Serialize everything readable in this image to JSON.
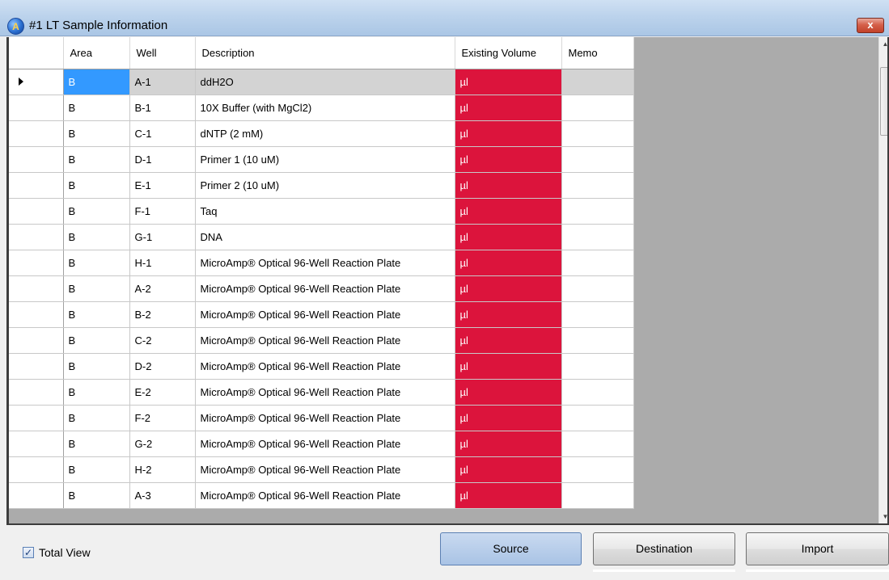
{
  "window": {
    "title": "#1 LT Sample Information",
    "app_icon": "autoit-globe-icon",
    "close_label": "x",
    "close_icon": "close-icon"
  },
  "grid": {
    "columns": [
      "Area",
      "Well",
      "Description",
      "Existing Volume",
      "Memo"
    ],
    "selected_row_index": 0,
    "volume_cell_color": "#dc143c",
    "selection_color": "#3399ff",
    "rows": [
      {
        "area": "B",
        "well": "A-1",
        "description": "ddH2O",
        "volume": "µl",
        "memo": ""
      },
      {
        "area": "B",
        "well": "B-1",
        "description": "10X Buffer (with MgCl2)",
        "volume": "µl",
        "memo": ""
      },
      {
        "area": "B",
        "well": "C-1",
        "description": "dNTP (2 mM)",
        "volume": "µl",
        "memo": ""
      },
      {
        "area": "B",
        "well": "D-1",
        "description": "Primer 1 (10 uM)",
        "volume": "µl",
        "memo": ""
      },
      {
        "area": "B",
        "well": "E-1",
        "description": "Primer 2 (10 uM)",
        "volume": "µl",
        "memo": ""
      },
      {
        "area": "B",
        "well": "F-1",
        "description": "Taq",
        "volume": "µl",
        "memo": ""
      },
      {
        "area": "B",
        "well": "G-1",
        "description": "DNA",
        "volume": "µl",
        "memo": ""
      },
      {
        "area": "B",
        "well": "H-1",
        "description": "MicroAmp® Optical 96-Well Reaction Plate",
        "volume": "µl",
        "memo": ""
      },
      {
        "area": "B",
        "well": "A-2",
        "description": "MicroAmp® Optical 96-Well Reaction Plate",
        "volume": "µl",
        "memo": ""
      },
      {
        "area": "B",
        "well": "B-2",
        "description": "MicroAmp® Optical 96-Well Reaction Plate",
        "volume": "µl",
        "memo": ""
      },
      {
        "area": "B",
        "well": "C-2",
        "description": "MicroAmp® Optical 96-Well Reaction Plate",
        "volume": "µl",
        "memo": ""
      },
      {
        "area": "B",
        "well": "D-2",
        "description": "MicroAmp® Optical 96-Well Reaction Plate",
        "volume": "µl",
        "memo": ""
      },
      {
        "area": "B",
        "well": "E-2",
        "description": "MicroAmp® Optical 96-Well Reaction Plate",
        "volume": "µl",
        "memo": ""
      },
      {
        "area": "B",
        "well": "F-2",
        "description": "MicroAmp® Optical 96-Well Reaction Plate",
        "volume": "µl",
        "memo": ""
      },
      {
        "area": "B",
        "well": "G-2",
        "description": "MicroAmp® Optical 96-Well Reaction Plate",
        "volume": "µl",
        "memo": ""
      },
      {
        "area": "B",
        "well": "H-2",
        "description": "MicroAmp® Optical 96-Well Reaction Plate",
        "volume": "µl",
        "memo": ""
      },
      {
        "area": "B",
        "well": "A-3",
        "description": "MicroAmp® Optical 96-Well Reaction Plate",
        "volume": "µl",
        "memo": ""
      }
    ]
  },
  "footer": {
    "total_view_label": "Total View",
    "total_view_checked": true,
    "source_label": "Source",
    "destination_label": "Destination",
    "import_label": "Import"
  }
}
